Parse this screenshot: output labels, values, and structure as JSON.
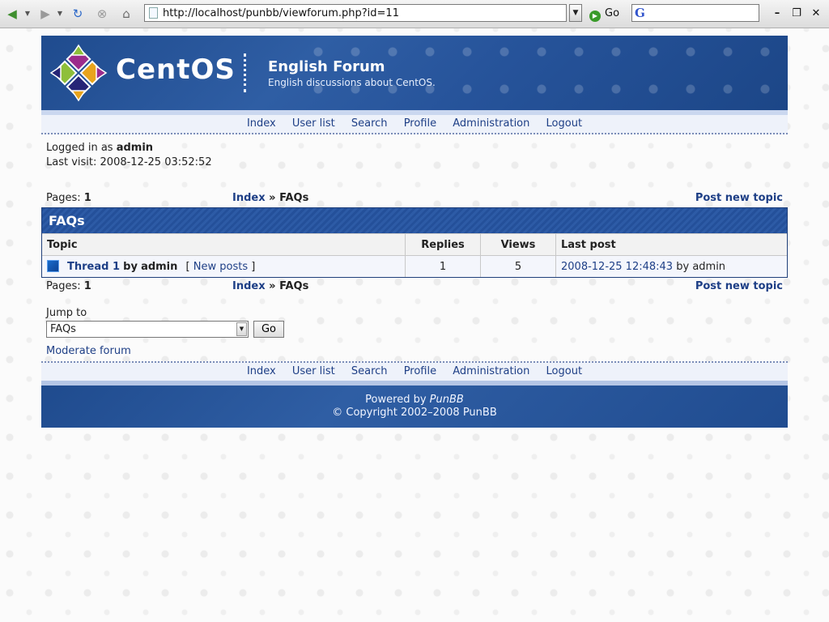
{
  "browser": {
    "url": "http://localhost/punbb/viewforum.php?id=11",
    "go_label": "Go"
  },
  "site": {
    "logo_text": "CentOS",
    "forum_title": "English Forum",
    "forum_description": "English discussions about CentOS."
  },
  "nav": {
    "items": [
      "Index",
      "User list",
      "Search",
      "Profile",
      "Administration",
      "Logout"
    ]
  },
  "user": {
    "logged_in_prefix": "Logged in as",
    "username": "admin",
    "last_visit_label": "Last visit:",
    "last_visit": "2008-12-25 03:52:52"
  },
  "pagination": {
    "label": "Pages:",
    "current": "1"
  },
  "breadcrumb": {
    "index": "Index",
    "separator": "»",
    "current": "FAQs"
  },
  "post_new_topic": "Post new topic",
  "forum_block": {
    "heading": "FAQs",
    "columns": {
      "topic": "Topic",
      "replies": "Replies",
      "views": "Views",
      "last_post": "Last post"
    },
    "topics": [
      {
        "title": "Thread 1",
        "by_label": "by",
        "author": "admin",
        "new_posts_label": "New posts",
        "replies": "1",
        "views": "5",
        "last_post_time": "2008-12-25 12:48:43",
        "last_post_by_label": "by",
        "last_post_author": "admin"
      }
    ]
  },
  "jump": {
    "label": "Jump to",
    "selected": "FAQs",
    "go_label": "Go"
  },
  "moderate_label": "Moderate forum",
  "footer": {
    "powered_by_label": "Powered by",
    "powered_by_brand": "PunBB",
    "copyright": "© Copyright 2002–2008 PunBB"
  },
  "colors": {
    "link": "#1e3f86",
    "header_blue": "#24509a",
    "row_bg": "#f4f6fc"
  }
}
